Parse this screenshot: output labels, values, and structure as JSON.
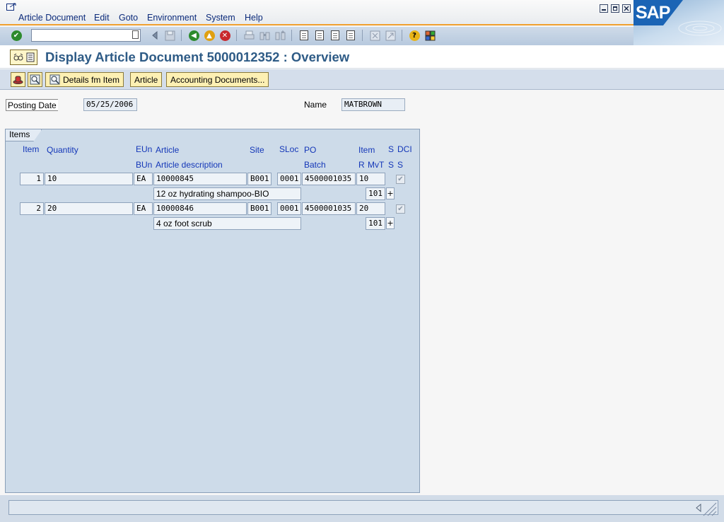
{
  "menu": {
    "items": [
      "Article Document",
      "Edit",
      "Goto",
      "Environment",
      "System",
      "Help"
    ]
  },
  "logo_text": "SAP",
  "toolbar": {
    "command_field_value": ""
  },
  "page": {
    "title": "Display Article Document 5000012352 : Overview"
  },
  "app_toolbar": {
    "details_label": "Details fm Item",
    "article_label": "Article",
    "accounting_label": "Accounting Documents..."
  },
  "header": {
    "posting_date_label": "Posting Date",
    "posting_date_value": "05/25/2006",
    "name_label": "Name",
    "name_value": "MATBROWN"
  },
  "items": {
    "group_label": "Items",
    "headers_row1": {
      "item": "Item",
      "quantity": "Quantity",
      "eun": "EUn",
      "article": "Article",
      "site": "Site",
      "sloc": "SLoc",
      "po": "PO",
      "po_item": "Item",
      "s": "S",
      "dci": "DCI"
    },
    "headers_row2": {
      "bun": "BUn",
      "article_description": "Article description",
      "batch": "Batch",
      "r": "R",
      "mvt": "MvT",
      "s": "S",
      "s2": "S"
    },
    "rows": [
      {
        "item": "1",
        "quantity": "10",
        "eun": "EA",
        "article": "10000845",
        "site": "B001",
        "sloc": "0001",
        "po": "4500001035",
        "po_item": "10",
        "dci_checked": true,
        "description": "12 oz hydrating shampoo-BIO",
        "mvt": "101"
      },
      {
        "item": "2",
        "quantity": "20",
        "eun": "EA",
        "article": "10000846",
        "site": "B001",
        "sloc": "0001",
        "po": "4500001035",
        "po_item": "20",
        "dci_checked": true,
        "description": "4 oz foot scrub",
        "mvt": "101"
      }
    ]
  },
  "colors": {
    "title": "#2e5b86",
    "column_header": "#1437b8",
    "button_face": "#fdf0b3",
    "group_bg": "#cddbe9"
  }
}
